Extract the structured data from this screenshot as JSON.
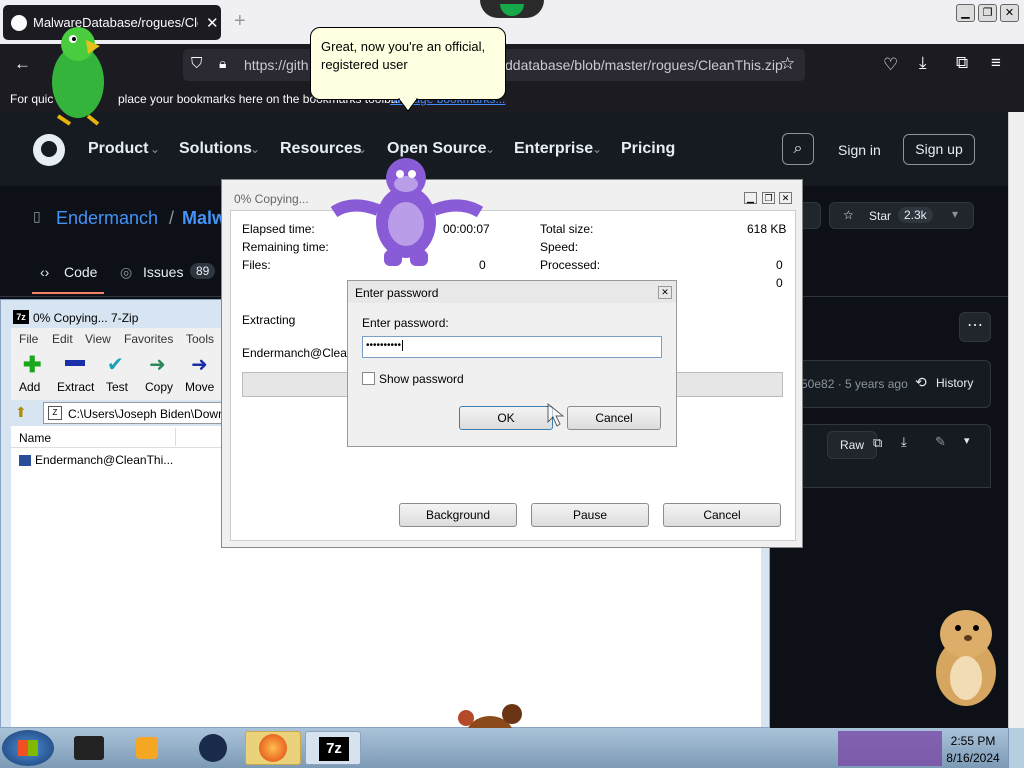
{
  "browser": {
    "tab_title": "MalwareDatabase/rogues/Clea",
    "close": "✕",
    "newtab": "+",
    "url_prefix": "https://gith",
    "url_suffix": "ddatabase/blob/master/rogues/CleanThis.zip",
    "bookmarks_text": "For quic",
    "bookmarks_text2": "place your bookmarks here on the bookmarks toolbar.",
    "bookmarks_link": "Manage bookmarks..."
  },
  "balloon": {
    "text": "Great, now you're an official, registered user"
  },
  "github": {
    "nav": [
      "Product",
      "Solutions",
      "Resources",
      "Open Source",
      "Enterprise",
      "Pricing"
    ],
    "sign_in": "Sign in",
    "sign_up": "Sign up",
    "repo_owner": "Endermanch",
    "repo_sep": "/",
    "repo_name": "Malw",
    "star": "Star",
    "star_count": "2.3k",
    "tab_code": "Code",
    "tab_issues": "Issues",
    "issues_count": "89",
    "commit": "50e82 · 5 years ago",
    "history": "History",
    "raw": "Raw"
  },
  "copy_dialog": {
    "title": "0% Copying...",
    "labels": {
      "elapsed": "Elapsed time:",
      "remaining": "Remaining time:",
      "files": "Files:",
      "total": "Total size:",
      "speed": "Speed:",
      "processed": "Processed:"
    },
    "values": {
      "elapsed": "00:00:07",
      "files": "0",
      "total": "618 KB",
      "processed": "0",
      "extra": "0"
    },
    "extracting": "Extracting",
    "path": "Endermanch@CleanTh",
    "background": "Background",
    "pause": "Pause",
    "cancel": "Cancel"
  },
  "password_dialog": {
    "title": "Enter password",
    "label": "Enter password:",
    "value": "••••••••••",
    "show": "Show password",
    "ok": "OK",
    "cancel": "Cancel"
  },
  "zip_window": {
    "title": "0% Copying... 7-Zip",
    "menu": [
      "File",
      "Edit",
      "View",
      "Favorites",
      "Tools"
    ],
    "toolbar": [
      "Add",
      "Extract",
      "Test",
      "Copy",
      "Move"
    ],
    "path": "C:\\Users\\Joseph Biden\\Down",
    "col_name": "Name",
    "file": "Endermanch@CleanThi..."
  },
  "taskbar": {
    "time": "2:55 PM",
    "date": "8/16/2024"
  }
}
